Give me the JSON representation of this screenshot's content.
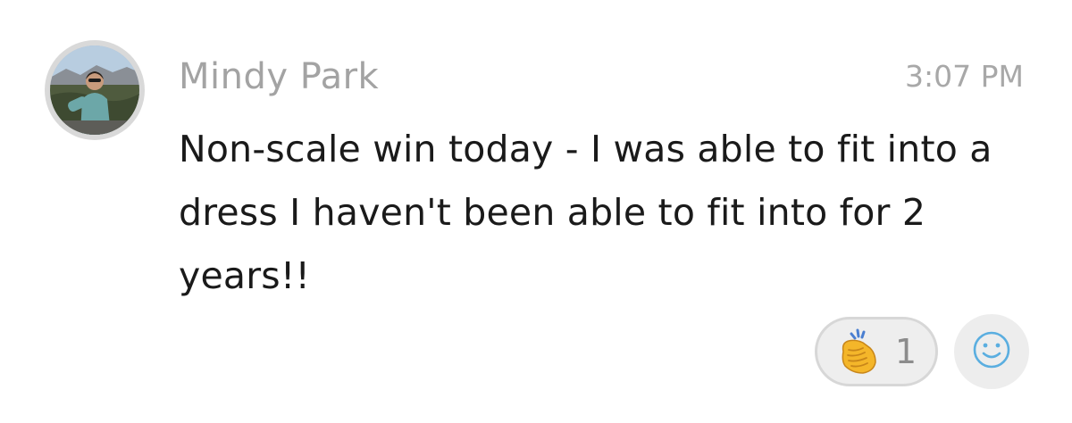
{
  "message": {
    "sender": "Mindy Park",
    "time": "3:07 PM",
    "text": "Non-scale win today - I was able to fit into a dress I haven't been able to fit into for 2 years!!"
  },
  "reactions": [
    {
      "icon": "clapping-hands-icon",
      "count": "1"
    }
  ],
  "add_reaction_icon": "smiley-face-icon",
  "colors": {
    "sender": "#a3a3a3",
    "timestamp": "#a8a8a8",
    "text": "#1a1a1a",
    "pill_bg": "#eeeeee",
    "pill_border": "#d7d7d7",
    "smiley_stroke": "#5aaee0",
    "clap": "#f2b928"
  }
}
